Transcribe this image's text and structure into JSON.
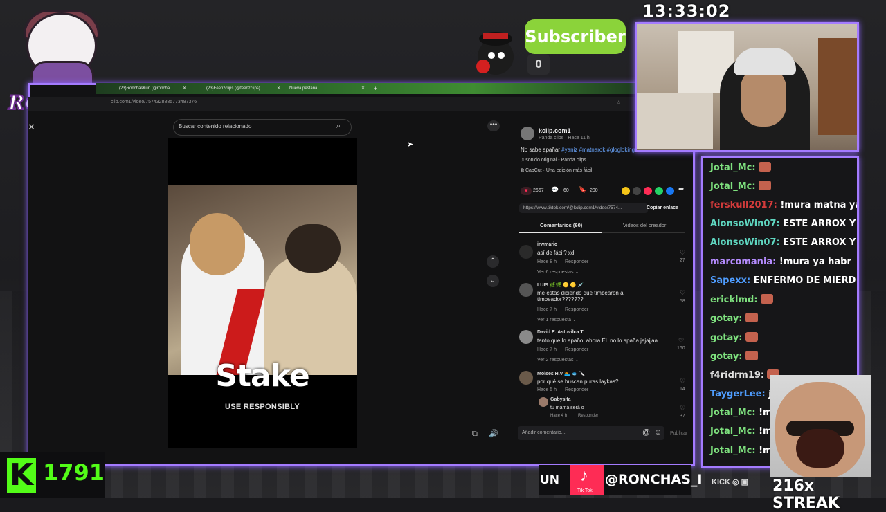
{
  "overlay": {
    "clock": "13:33:02",
    "logo_text": "RONCHAS",
    "subscriber_label": "Subscriber",
    "subscriber_count": "0",
    "kick_count": "1791",
    "kick_logo": "K",
    "social_prefix": "UN",
    "social_handle": "@RONCHAS_I",
    "tiktok_label": "Tik Tok",
    "bottom_icons": "KICK",
    "streak": "216x STREAK",
    "accent": "#a47bff",
    "kick_green": "#53fc18"
  },
  "browser": {
    "tabs": [
      {
        "label": "(23)RonchasKun (@roncha"
      },
      {
        "label": "(23)Feenzclips (@feenzclips) |"
      },
      {
        "label": "Nueva pestaña"
      }
    ],
    "url": "clip.com1/video/7574328885773487376"
  },
  "page": {
    "search_placeholder": "Buscar contenido relacionado",
    "stake_text": "Stake",
    "use_responsibly": "USE RESPONSIBLY",
    "author": {
      "name": "kclip.com1",
      "meta": "Panda clips · Hace 11 h",
      "caption": "No sabe apañar",
      "hashtags": "#yaniz #matnarok #glogloking #emikukis",
      "sound": "sonido original - Panda clips",
      "capcut": "CapCut · Una edición más fácil"
    },
    "stats": {
      "likes": "2667",
      "comments": "60",
      "saves": "200"
    },
    "share_url": "https://www.tiktok.com/@kclip.com1/video/7574...",
    "copy_link": "Copiar enlace",
    "tab_comments": "Comentarios (60)",
    "tab_creator": "Videos del creador",
    "comments": [
      {
        "user": "irwmario",
        "text": "así de fácil? xd",
        "time": "Hace 8 h",
        "reply": "Responder",
        "likes": "27",
        "more": "Ver 6 respuestas ⌄"
      },
      {
        "user": "LUIS 🌿🌿 🟡 🟡 💉",
        "text": "me estás diciendo que timbearon al timbeador???????",
        "time": "Hace 7 h",
        "reply": "Responder",
        "likes": "58",
        "more": "Ver 1 respuesta ⌄"
      },
      {
        "user": "David E. Astuvilca T",
        "text": "tanto que lo apaño, ahora ÉL no lo apaña jajajjaa",
        "time": "Hace 7 h",
        "reply": "Responder",
        "likes": "160",
        "more": "Ver 2 respuestas ⌄"
      },
      {
        "user": "Moises H.V 🏊 🐟 🔪",
        "text": "por qué se buscan puras laykas?",
        "time": "Hace 5 h",
        "reply": "Responder",
        "likes": "14",
        "more": ""
      }
    ],
    "reply": {
      "user": "Gabysita",
      "text": "tu mamá será o",
      "time": "Hace 4 h",
      "reply": "Responder",
      "likes": "37"
    },
    "comment_placeholder": "Añadir comentario...",
    "publish": "Publicar"
  },
  "chat": [
    {
      "user": "Jotal_Mc:",
      "text": "",
      "color": "#7ee07e",
      "emote": true
    },
    {
      "user": "Jotal_Mc:",
      "text": "",
      "color": "#7ee07e",
      "emote": true
    },
    {
      "user": "ferskull2017:",
      "text": " !mura matna ya l",
      "color": "#d33b3b",
      "emote": false
    },
    {
      "user": "AlonsoWin07:",
      "text": " ESTE ARROX Y",
      "color": "#5fd6c0",
      "emote": false
    },
    {
      "user": "AlonsoWin07:",
      "text": " ESTE ARROX Y",
      "color": "#5fd6c0",
      "emote": false
    },
    {
      "user": "marcomania:",
      "text": " !mura ya habr",
      "color": "#b58cff",
      "emote": false
    },
    {
      "user": "Sapexx:",
      "text": " ENFERMO DE MIERD",
      "color": "#4f9dff",
      "emote": false
    },
    {
      "user": "ericklmd:",
      "text": "",
      "color": "#7ee07e",
      "emote": true
    },
    {
      "user": "gotay:",
      "text": "",
      "color": "#7ee07e",
      "emote": true
    },
    {
      "user": "gotay:",
      "text": "",
      "color": "#7ee07e",
      "emote": true
    },
    {
      "user": "gotay:",
      "text": "",
      "color": "#7ee07e",
      "emote": true
    },
    {
      "user": "f4ridrm19:",
      "text": "",
      "color": "#e0e0e0",
      "emote": true
    },
    {
      "user": "TaygerLee:",
      "text": " ja",
      "color": "#4f9dff",
      "emote": false
    },
    {
      "user": "Jotal_Mc:",
      "text": " !mu",
      "color": "#7ee07e",
      "emote": false
    },
    {
      "user": "Jotal_Mc:",
      "text": " !mu",
      "color": "#7ee07e",
      "emote": false
    },
    {
      "user": "Jotal_Mc:",
      "text": " !mu",
      "color": "#7ee07e",
      "emote": false
    }
  ]
}
